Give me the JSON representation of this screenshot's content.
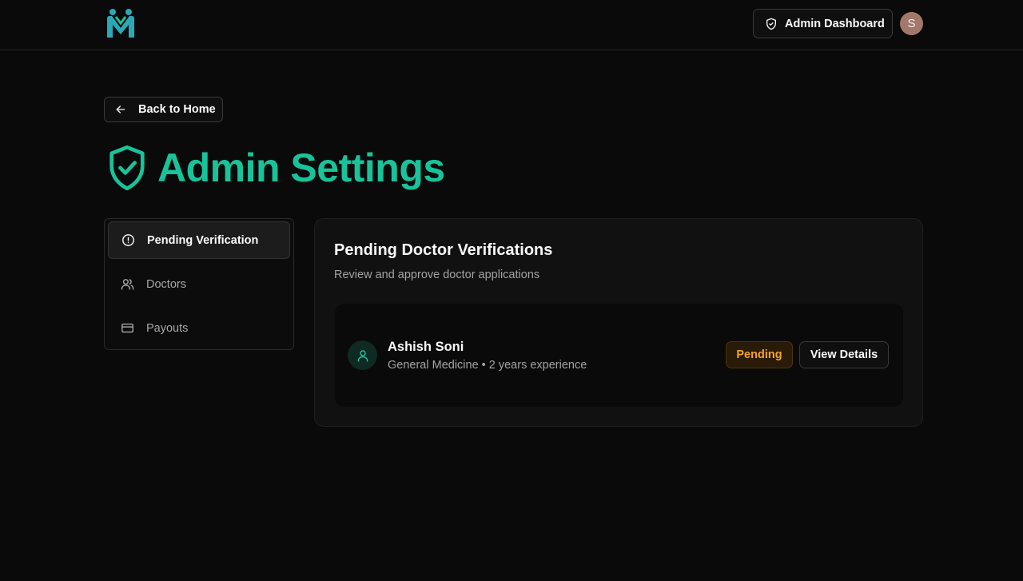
{
  "header": {
    "admin_button_label": "Admin Dashboard",
    "avatar_initial": "S"
  },
  "back_button_label": "Back to Home",
  "page_title": "Admin Settings",
  "sidebar": {
    "items": [
      {
        "label": "Pending Verification",
        "icon": "alert-circle-icon",
        "active": true
      },
      {
        "label": "Doctors",
        "icon": "users-icon",
        "active": false
      },
      {
        "label": "Payouts",
        "icon": "credit-card-icon",
        "active": false
      }
    ]
  },
  "panel": {
    "title": "Pending Doctor Verifications",
    "subtitle": "Review and approve doctor applications",
    "doctors": [
      {
        "name": "Ashish Soni",
        "meta": "General Medicine • 2 years experience",
        "status": "Pending",
        "action_label": "View Details"
      }
    ]
  },
  "colors": {
    "accent": "#19c39a",
    "background": "#0a0a0a",
    "pending": "#f5a524"
  }
}
